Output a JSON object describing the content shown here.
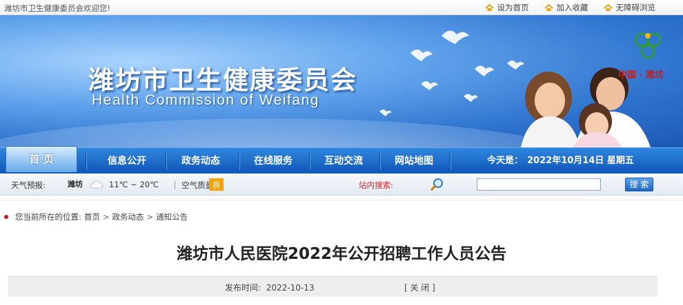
{
  "topbar": {
    "welcome": "潍坊市卫生健康委员会欢迎您!",
    "links": [
      "设为首页",
      "加入收藏",
      "无障碍浏览"
    ],
    "link_icon": "house-icon",
    "link_icon_color": "#e8a317"
  },
  "banner": {
    "title_cn": "潍坊市卫生健康委员会",
    "title_en": "Health Commission of Weifang",
    "logo_text": "中国 · 潍坊",
    "logo_color": "#2e9a3a"
  },
  "nav": {
    "home": "首 页",
    "items": [
      "信息公开",
      "政务动态",
      "在线服务",
      "互动交流",
      "网站地图"
    ],
    "today_label": "今天是：",
    "today_value": "2022年10月14日 星期五"
  },
  "weather": {
    "label": "天气预报:",
    "city": "潍坊",
    "temp": "11℃ ~ 20℃",
    "air_label": "｜ 空气质量:",
    "air_value": "良",
    "air_color": "#f5a400"
  },
  "search": {
    "label": "站内搜索:",
    "placeholder": "",
    "button": "搜 索"
  },
  "breadcrumb": {
    "prefix": "您当前所在的位置:",
    "items": [
      "首页",
      "政务动态",
      "通知公告"
    ]
  },
  "article": {
    "title": "潍坊市人民医院2022年公开招聘工作人员公告",
    "date_label": "发布时间:",
    "date": "2022-10-13",
    "close": "[ 关 闭 ]"
  }
}
